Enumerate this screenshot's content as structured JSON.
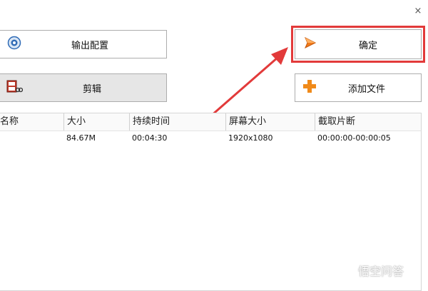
{
  "window": {
    "close_glyph": "×"
  },
  "buttons": {
    "output_config": {
      "label": "输出配置",
      "icon": "gear-icon"
    },
    "clip": {
      "label": "剪辑",
      "icon": "film-edit-icon"
    },
    "confirm": {
      "label": "确定",
      "icon": "arrow-right-icon"
    },
    "add_file": {
      "label": "添加文件",
      "icon": "plus-icon"
    }
  },
  "colors": {
    "highlight": "#e23a3a",
    "confirm_icon": "#f07a1a",
    "plus_icon": "#f08a1a",
    "gear_icon": "#2f6bb6"
  },
  "table": {
    "columns": [
      "名称",
      "大小",
      "持续时间",
      "屏幕大小",
      "截取片断"
    ],
    "rows": [
      {
        "name": "",
        "size": "84.67M",
        "duration": "00:04:30",
        "resolution": "1920x1080",
        "clip": "00:00:00-00:00:05"
      }
    ]
  },
  "watermark": {
    "text": "悟空问答"
  }
}
